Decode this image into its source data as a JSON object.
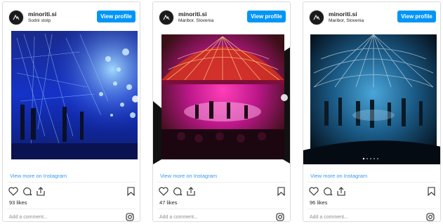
{
  "posts": [
    {
      "username": "minoriti.si",
      "location": "Sodni stolp",
      "view_profile": "View profile",
      "view_more": "View more on Instagram",
      "likes": "93 likes",
      "comment_placeholder": "Add a comment...",
      "image_icon": "installation-light-photo"
    },
    {
      "username": "minoriti.si",
      "location": "Maribor, Slovenia",
      "view_profile": "View profile",
      "view_more": "View more on Instagram",
      "likes": "47 likes",
      "comment_placeholder": "Add a comment...",
      "image_icon": "dome-concert-photo"
    },
    {
      "username": "minoriti.si",
      "location": "Maribor, Slovenia",
      "view_profile": "View profile",
      "view_more": "View more on Instagram",
      "likes": "96 likes",
      "comment_placeholder": "Add a comment...",
      "image_icon": "dome-concert-photo"
    }
  ],
  "colors": {
    "button_blue": "#0095f6",
    "link_blue": "#3897f0",
    "text": "#262626",
    "muted": "#8e8e8e",
    "border": "#dbdbdb"
  },
  "icons": [
    "heart-icon",
    "comment-icon",
    "share-icon",
    "bookmark-icon",
    "instagram-icon",
    "next-arrow-icon"
  ]
}
